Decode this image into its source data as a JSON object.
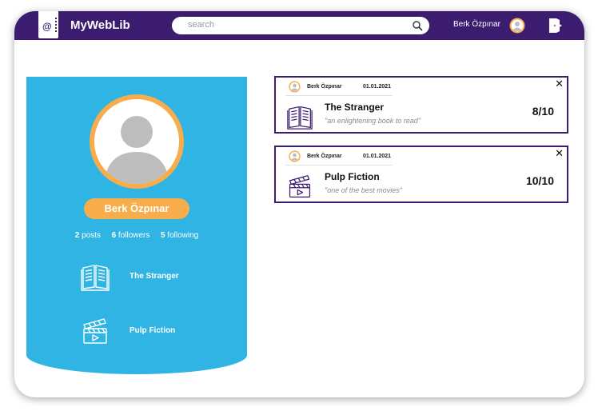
{
  "app": {
    "brand": "MyWebLib"
  },
  "header": {
    "search_placeholder": "search",
    "username": "Berk Özpınar"
  },
  "profile": {
    "name": "Berk Özpınar",
    "stats": {
      "posts_count": "2",
      "posts_label": "posts",
      "followers_count": "6",
      "followers_label": "followers",
      "following_count": "5",
      "following_label": "following"
    },
    "items": [
      {
        "label": "The Stranger",
        "icon": "book-icon"
      },
      {
        "label": "Pulp Fiction",
        "icon": "clapperboard-icon"
      }
    ]
  },
  "feed": [
    {
      "author": "Berk Özpınar",
      "date": "01.01.2021",
      "title": "The Stranger",
      "quote": "\"an enlightening book to read\"",
      "score": "8/10",
      "icon": "book-icon"
    },
    {
      "author": "Berk Özpınar",
      "date": "01.01.2021",
      "title": "Pulp Fiction",
      "quote": "\"one of the best movies\"",
      "score": "10/10",
      "icon": "clapperboard-icon"
    }
  ],
  "colors": {
    "navbar": "#3b1c6e",
    "profile_panel": "#2fb4e4",
    "accent_orange": "#f7ad4b"
  }
}
